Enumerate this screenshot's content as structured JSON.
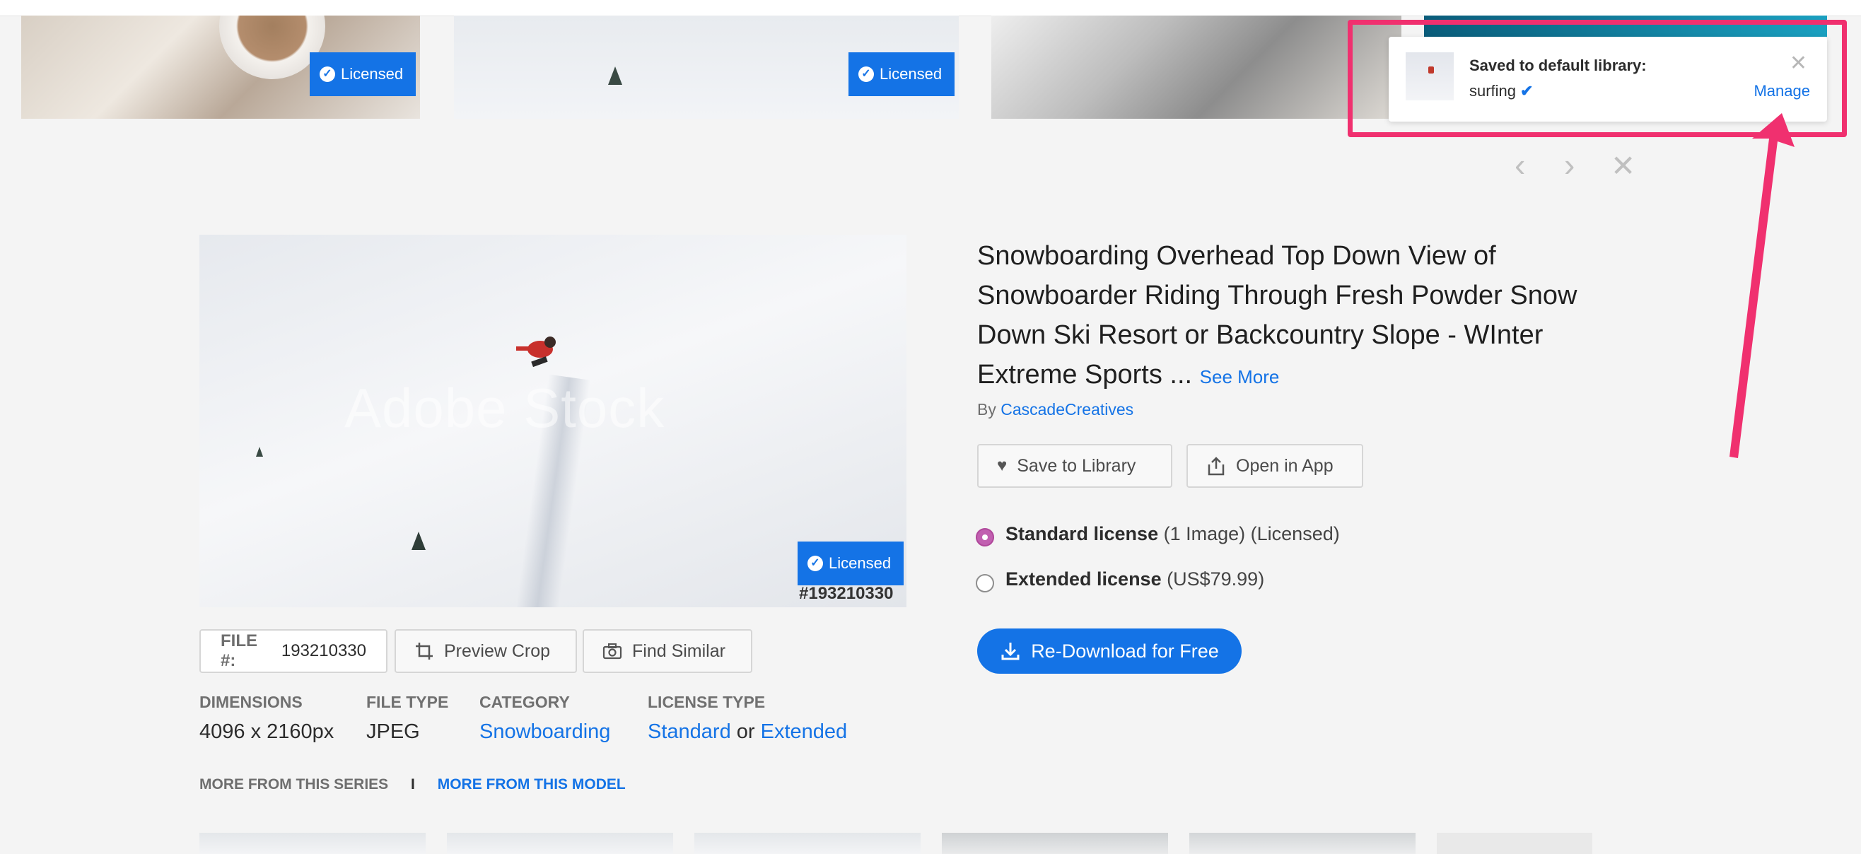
{
  "top_thumbnails": [
    {
      "badge": "Licensed"
    },
    {
      "badge": "Licensed"
    }
  ],
  "toast": {
    "title": "Saved to default library:",
    "library": "surfing",
    "manage": "Manage",
    "close": "✕"
  },
  "nav": {
    "prev": "‹",
    "next": "›",
    "close": "✕"
  },
  "asset": {
    "title": "Snowboarding Overhead Top Down View of Snowboarder Riding Through Fresh Powder Snow Down Ski Resort or Backcountry Slope - WInter Extreme Sports ...",
    "see_more": "See More",
    "by_label": "By",
    "author": "CascadeCreatives",
    "preview_badge": "Licensed",
    "watermark": "Adobe Stock",
    "file_id_overlay": "#193210330"
  },
  "actions": {
    "save_to_library": "Save to Library",
    "open_in_app": "Open in App",
    "preview_crop": "Preview Crop",
    "find_similar": "Find Similar",
    "redownload": "Re-Download for Free"
  },
  "licenses": [
    {
      "name": "Standard license",
      "detail": "(1 Image) (Licensed)",
      "selected": true
    },
    {
      "name": "Extended license",
      "detail": "(US$79.99)",
      "selected": false
    }
  ],
  "file": {
    "label": "FILE #:",
    "value": "193210330"
  },
  "meta": {
    "dimensions_label": "DIMENSIONS",
    "dimensions": "4096 x 2160px",
    "filetype_label": "FILE TYPE",
    "filetype": "JPEG",
    "category_label": "CATEGORY",
    "category": "Snowboarding",
    "license_label": "LICENSE TYPE",
    "license_standard": "Standard",
    "license_or": "or",
    "license_extended": "Extended"
  },
  "series": {
    "more_series": "MORE FROM THIS SERIES",
    "separator": "I",
    "more_model": "MORE FROM THIS MODEL"
  },
  "colors": {
    "accent": "#1473e6",
    "highlight": "#f0306f",
    "radio_selected": "#c15fb0"
  },
  "icons": [
    "check-icon",
    "close-icon",
    "chevron-left-icon",
    "chevron-right-icon",
    "heart-icon",
    "share-icon",
    "crop-icon",
    "camera-icon",
    "download-icon"
  ]
}
